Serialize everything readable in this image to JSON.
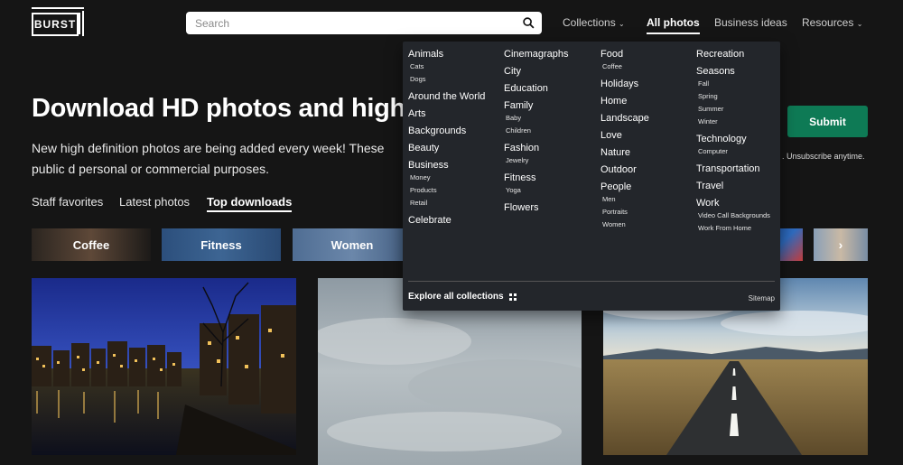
{
  "header": {
    "logo_text": "BURST",
    "search_placeholder": "Search",
    "nav": [
      "Collections",
      "All photos",
      "Business ideas",
      "Resources"
    ],
    "nav_active": "All photos"
  },
  "hero": {
    "title": "Download HD photos and high-res",
    "subtitle": "New high definition photos are being added every week! These public d personal or commercial purposes.",
    "submit_label": "Submit",
    "unsubscribe_text": ". Unsubscribe anytime."
  },
  "tabs": [
    "Staff favorites",
    "Latest photos",
    "Top downloads"
  ],
  "tabs_active": "Top downloads",
  "categories": [
    "Coffee",
    "Fitness",
    "Women"
  ],
  "dropdown": {
    "col1": [
      {
        "label": "Animals",
        "subs": [
          "Cats",
          "Dogs"
        ]
      },
      {
        "label": "Around the World",
        "subs": []
      },
      {
        "label": "Arts",
        "subs": []
      },
      {
        "label": "Backgrounds",
        "subs": []
      },
      {
        "label": "Beauty",
        "subs": []
      },
      {
        "label": "Business",
        "subs": [
          "Money",
          "Products",
          "Retail"
        ]
      },
      {
        "label": "Celebrate",
        "subs": []
      }
    ],
    "col2": [
      {
        "label": "Cinemagraphs",
        "subs": []
      },
      {
        "label": "City",
        "subs": []
      },
      {
        "label": "Education",
        "subs": []
      },
      {
        "label": "Family",
        "subs": [
          "Baby",
          "Children"
        ]
      },
      {
        "label": "Fashion",
        "subs": [
          "Jewelry"
        ]
      },
      {
        "label": "Fitness",
        "subs": [
          "Yoga"
        ]
      },
      {
        "label": "Flowers",
        "subs": []
      }
    ],
    "col3": [
      {
        "label": "Food",
        "subs": [
          "Coffee"
        ]
      },
      {
        "label": "Holidays",
        "subs": []
      },
      {
        "label": "Home",
        "subs": []
      },
      {
        "label": "Landscape",
        "subs": []
      },
      {
        "label": "Love",
        "subs": []
      },
      {
        "label": "Nature",
        "subs": []
      },
      {
        "label": "Outdoor",
        "subs": []
      },
      {
        "label": "People",
        "subs": [
          "Men",
          "Portraits",
          "Women"
        ]
      }
    ],
    "col4": [
      {
        "label": "Recreation",
        "subs": []
      },
      {
        "label": "Seasons",
        "subs": [
          "Fall",
          "Spring",
          "Summer",
          "Winter"
        ]
      },
      {
        "label": "Technology",
        "subs": [
          "Computer"
        ]
      },
      {
        "label": "Transportation",
        "subs": []
      },
      {
        "label": "Travel",
        "subs": []
      },
      {
        "label": "Work",
        "subs": [
          "Video Call Backgrounds",
          "Work From Home"
        ]
      }
    ],
    "footer_label": "Explore all collections",
    "sitemap_label": "Sitemap"
  },
  "colors": {
    "background": "#151515",
    "dropdown_bg": "#23262b",
    "submit": "#0e7a55"
  }
}
